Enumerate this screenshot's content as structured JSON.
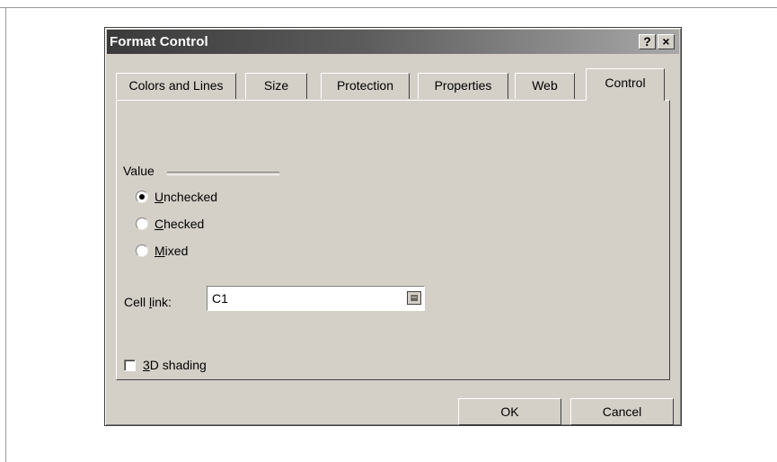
{
  "window": {
    "title": "Format Control",
    "help_label": "?",
    "close_label": "×"
  },
  "tabs": [
    {
      "label": "Colors and Lines",
      "active": false
    },
    {
      "label": "Size",
      "active": false
    },
    {
      "label": "Protection",
      "active": false
    },
    {
      "label": "Properties",
      "active": false
    },
    {
      "label": "Web",
      "active": false
    },
    {
      "label": "Control",
      "active": true
    }
  ],
  "value_group": {
    "label": "Value",
    "options": [
      {
        "accel": "U",
        "rest": "nchecked",
        "selected": true
      },
      {
        "accel": "C",
        "rest": "hecked",
        "selected": false
      },
      {
        "accel": "M",
        "rest": "ixed",
        "selected": false
      }
    ]
  },
  "cell_link": {
    "label_pre": "Cell ",
    "label_accel": "l",
    "label_post": "ink:",
    "value": "C1",
    "button_icon": "collapse-dialog-icon"
  },
  "shading": {
    "accel": "3",
    "rest": "D shading",
    "checked": false
  },
  "buttons": {
    "ok": "OK",
    "cancel": "Cancel"
  }
}
